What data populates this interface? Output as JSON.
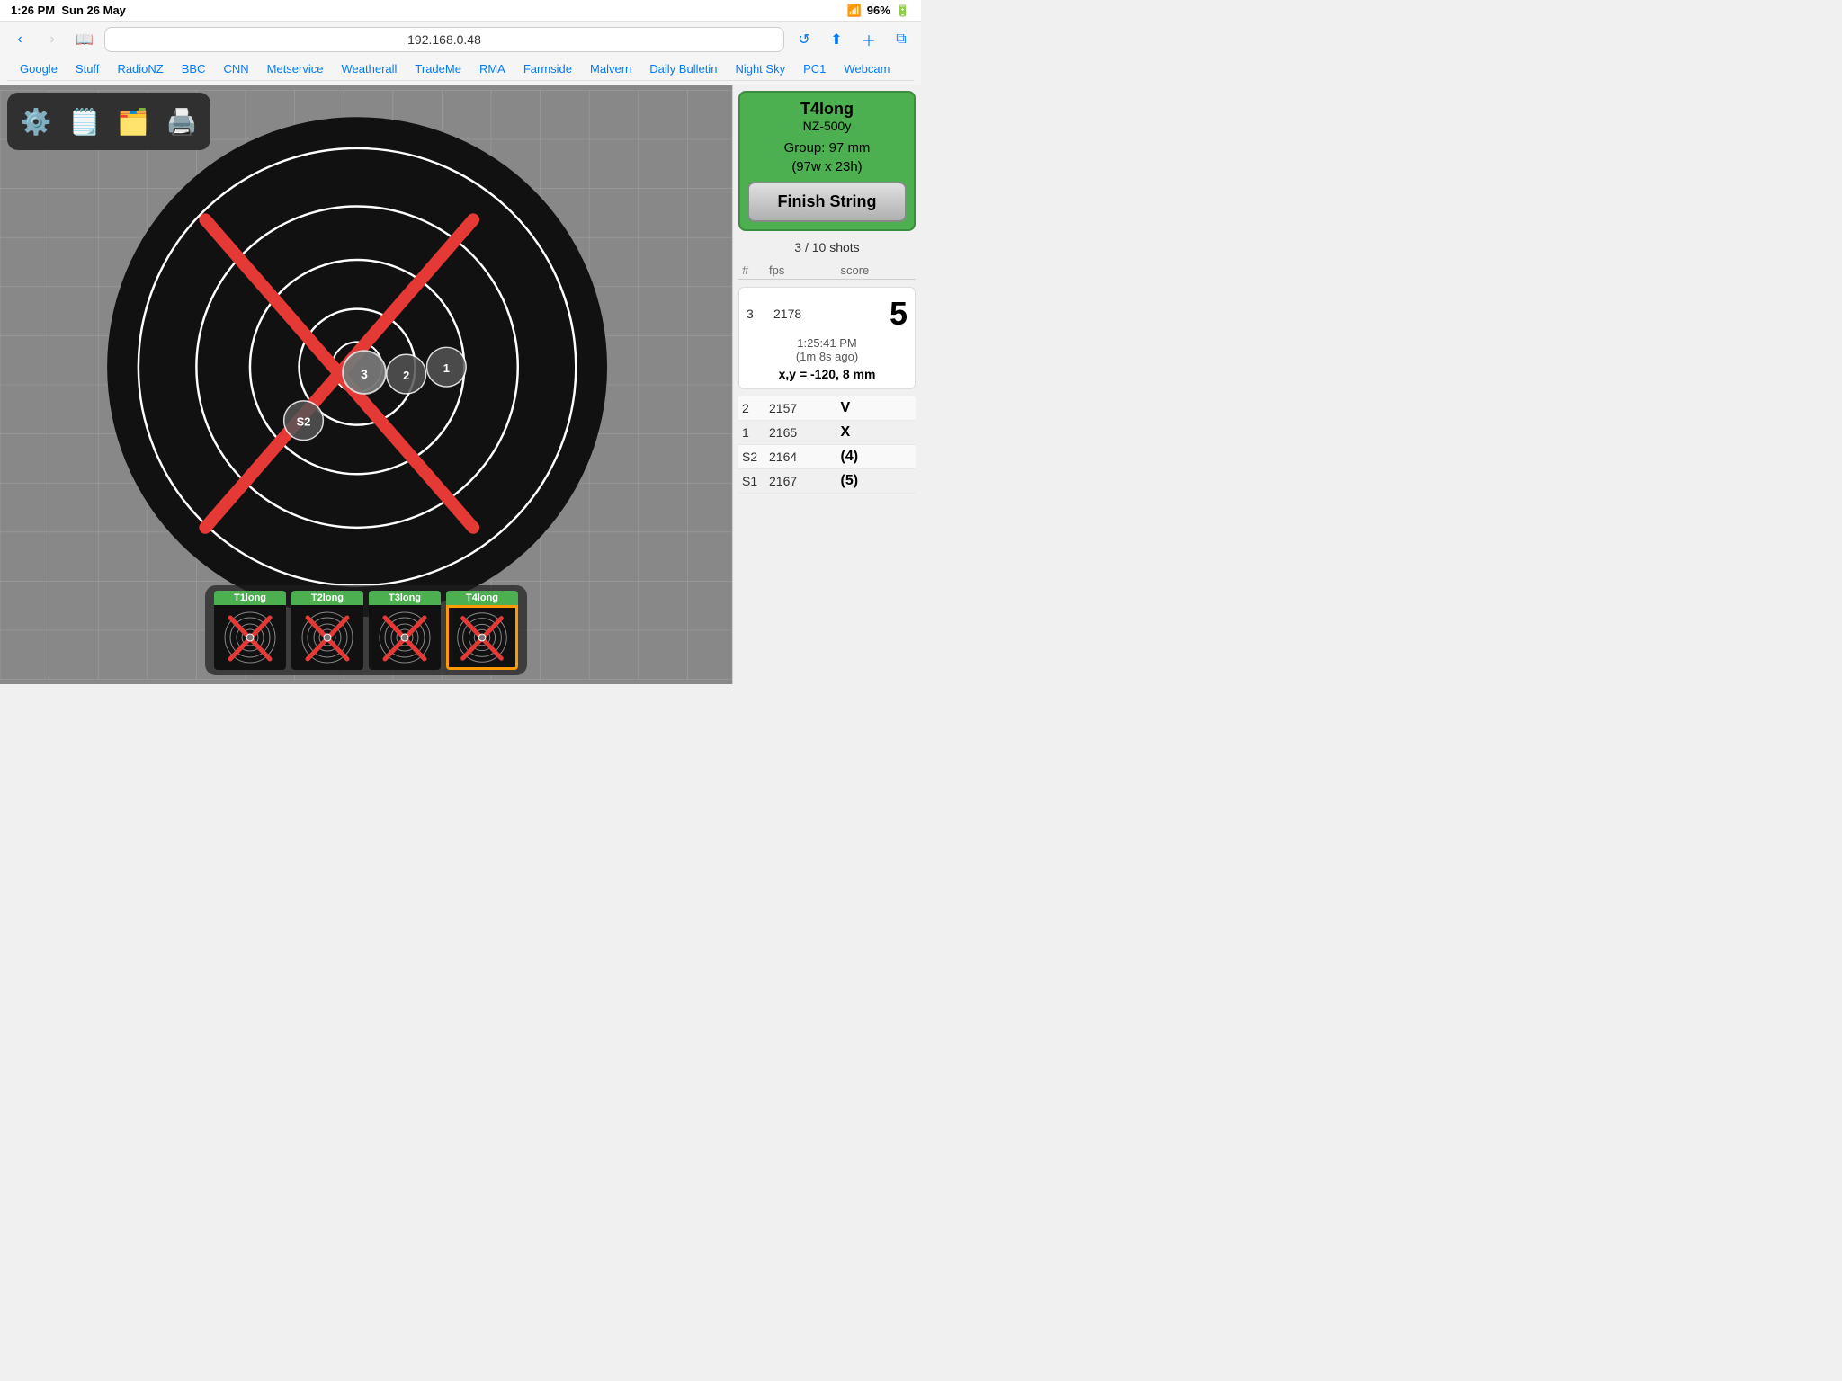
{
  "statusBar": {
    "time": "1:26 PM",
    "date": "Sun 26 May",
    "wifi": "96%"
  },
  "browser": {
    "url": "192.168.0.48",
    "back_label": "‹",
    "forward_label": "›",
    "bookmarks_label": "⊞",
    "reload_label": "↺",
    "share_label": "↑",
    "add_label": "+",
    "tabs_label": "⧉"
  },
  "bookmarks": [
    {
      "label": "Google"
    },
    {
      "label": "Stuff"
    },
    {
      "label": "RadioNZ"
    },
    {
      "label": "BBC"
    },
    {
      "label": "CNN"
    },
    {
      "label": "Metservice"
    },
    {
      "label": "Weatherall"
    },
    {
      "label": "TradeMe"
    },
    {
      "label": "RMA"
    },
    {
      "label": "Farmside"
    },
    {
      "label": "Malvern"
    },
    {
      "label": "Daily Bulletin"
    },
    {
      "label": "Night Sky"
    },
    {
      "label": "PC1"
    },
    {
      "label": "Webcam"
    }
  ],
  "toolbar": {
    "settings_icon": "⚙",
    "notes_icon": "📝",
    "folder_icon": "📁",
    "print_icon": "🖨"
  },
  "panel": {
    "title": "T4long",
    "subtitle": "NZ-500y",
    "group_line1": "Group: 97 mm",
    "group_line2": "(97w x 23h)",
    "finish_string": "Finish String",
    "shots_info": "3 / 10 shots",
    "col_num": "#",
    "col_fps": "fps",
    "col_score": "score",
    "featured_shot": {
      "num": "3",
      "fps": "2178",
      "score": "5",
      "time": "1:25:41 PM",
      "ago": "(1m 8s ago)",
      "xy_label": "x,y =",
      "xy_value": "-120, 8 mm"
    },
    "other_shots": [
      {
        "num": "2",
        "fps": "2157",
        "score": "V"
      },
      {
        "num": "1",
        "fps": "2165",
        "score": "X"
      },
      {
        "num": "S2",
        "fps": "2164",
        "score": "(4)"
      },
      {
        "num": "S1",
        "fps": "2167",
        "score": "(5)"
      }
    ]
  },
  "thumbnails": [
    {
      "label": "T1long",
      "active": false
    },
    {
      "label": "T2long",
      "active": false
    },
    {
      "label": "T3long",
      "active": false
    },
    {
      "label": "T4long",
      "active": true
    }
  ]
}
